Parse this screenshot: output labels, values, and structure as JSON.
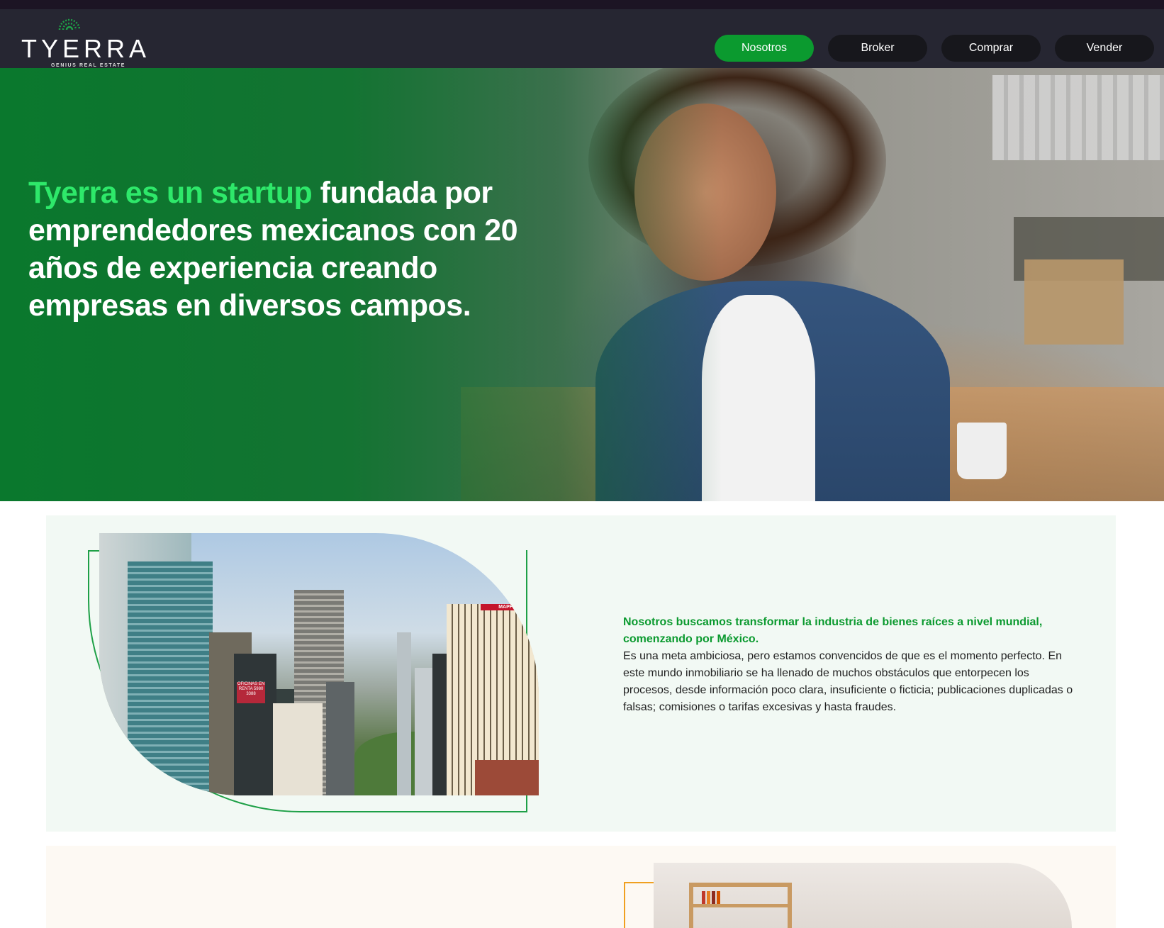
{
  "header": {
    "logo": {
      "word": "TYERRA",
      "tagline": "GENIUS REAL ESTATE"
    },
    "nav": [
      {
        "label": "Nosotros",
        "active": true
      },
      {
        "label": "Broker",
        "active": false
      },
      {
        "label": "Comprar",
        "active": false
      },
      {
        "label": "Vender",
        "active": false
      }
    ]
  },
  "hero": {
    "title_accent": "Tyerra es un startup",
    "title_rest": " fundada por emprendedores mexicanos con 20 años de experiencia creando empresas en diversos campos."
  },
  "section1": {
    "lead": "Nosotros buscamos transformar la industria de bienes raíces a nivel mundial, comenzando por México.",
    "body": "Es una meta ambiciosa, pero estamos convencidos de que es el momento perfecto. En este mundo inmobiliario se ha llenado de muchos obstáculos que entorpecen los procesos, desde información poco clara, insuficiente o ficticia; publicaciones duplicadas o falsas; comisiones o tarifas excesivas y hasta fraudes.",
    "image_sign": "OFICINAS EN RENTA 5980 3388",
    "image_building_label": "MAPFRE"
  },
  "colors": {
    "accent": "#0b9a2f",
    "hero_accent": "#2ee86a",
    "nav_bg": "#262632",
    "secondary_frame": "#f0a020"
  }
}
